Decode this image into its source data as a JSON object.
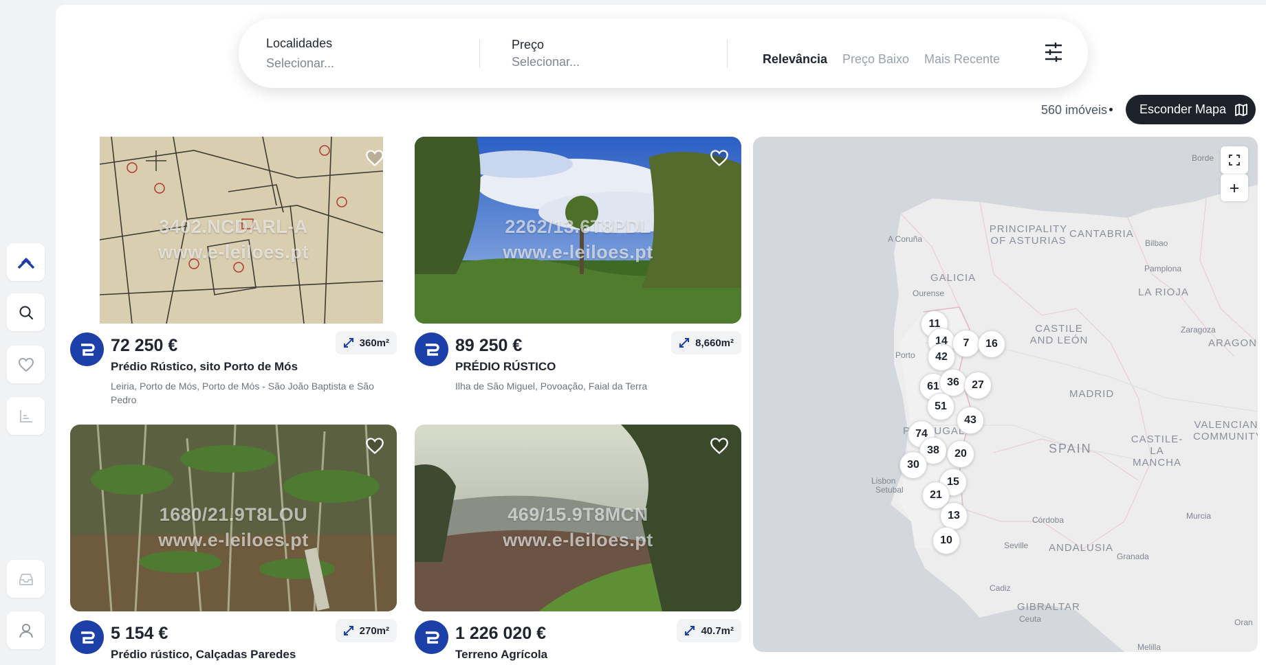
{
  "search": {
    "localidades_label": "Localidades",
    "localidades_placeholder": "Selecionar...",
    "preco_label": "Preço",
    "preco_placeholder": "Selecionar...",
    "sort_options": [
      "Relevância",
      "Preço Baixo",
      "Mais Recente"
    ],
    "active_sort": "Relevância"
  },
  "results": {
    "count": "560 imóveis",
    "map_toggle_label": "Esconder Mapa"
  },
  "listings": [
    {
      "price": "72 250 €",
      "area": "360m²",
      "title": "Prédio Rústico, sito Porto de Mós",
      "location": "Leiria, Porto de Mós, Porto de Mós - São João Baptista e São Pedro",
      "watermark_ref": "3402.NCDARL-A",
      "watermark_site": "www.e-leiloes.pt"
    },
    {
      "price": "89 250 €",
      "area": "8,660m²",
      "title": "PRÉDIO RÚSTICO",
      "location": "Ilha de São Miguel, Povoação, Faial da Terra",
      "watermark_ref": "2262/13.6T8PDL",
      "watermark_site": "www.e-leiloes.pt"
    },
    {
      "price": "5 154 €",
      "area": "270m²",
      "title": "Prédio rústico, Calçadas Paredes",
      "location": "",
      "watermark_ref": "1680/21.9T8LOU",
      "watermark_site": "www.e-leiloes.pt"
    },
    {
      "price": "1 226 020 €",
      "area": "40.7m²",
      "title": "Terreno Agrícola",
      "location": "",
      "watermark_ref": "469/15.9T8MCN",
      "watermark_site": "www.e-leiloes.pt"
    }
  ],
  "map": {
    "regions": [
      "PRINCIPALITY OF ASTURIAS",
      "CANTABRIA",
      "GALICIA",
      "LA RIOJA",
      "CASTILE AND LEÓN",
      "ARAGON",
      "MADRID",
      "PORTUGAL",
      "SPAIN",
      "CASTILE-LA MANCHA",
      "VALENCIAN COMMUNITY",
      "ANDALUSIA",
      "GIBRALTAR"
    ],
    "cities": [
      "A Coruña",
      "Bilbao",
      "Pamplona",
      "Ourense",
      "Zaragoza",
      "Porto",
      "Lisbon",
      "Setubal",
      "Córdoba",
      "Murcia",
      "Seville",
      "Granada",
      "Cadiz",
      "Ceuta",
      "Oran",
      "Melilla",
      "Borde"
    ],
    "markers": [
      "11",
      "14",
      "7",
      "16",
      "42",
      "61",
      "36",
      "27",
      "51",
      "43",
      "74",
      "38",
      "20",
      "30",
      "15",
      "21",
      "13",
      "10"
    ]
  },
  "icons": {
    "sidebar": [
      "logo-icon",
      "search-icon",
      "heart-icon",
      "chart-icon",
      "inbox-icon",
      "user-icon"
    ],
    "controls": [
      "filter-sliders-icon",
      "map-icon",
      "fullscreen-icon",
      "zoom-in-icon",
      "expand-arrows-icon",
      "heart-outline-icon"
    ]
  },
  "colors": {
    "accent": "#1c3fa8",
    "dark_button": "#1e222b",
    "map_land": "#ededee",
    "map_sea": "#d4d7dc"
  }
}
